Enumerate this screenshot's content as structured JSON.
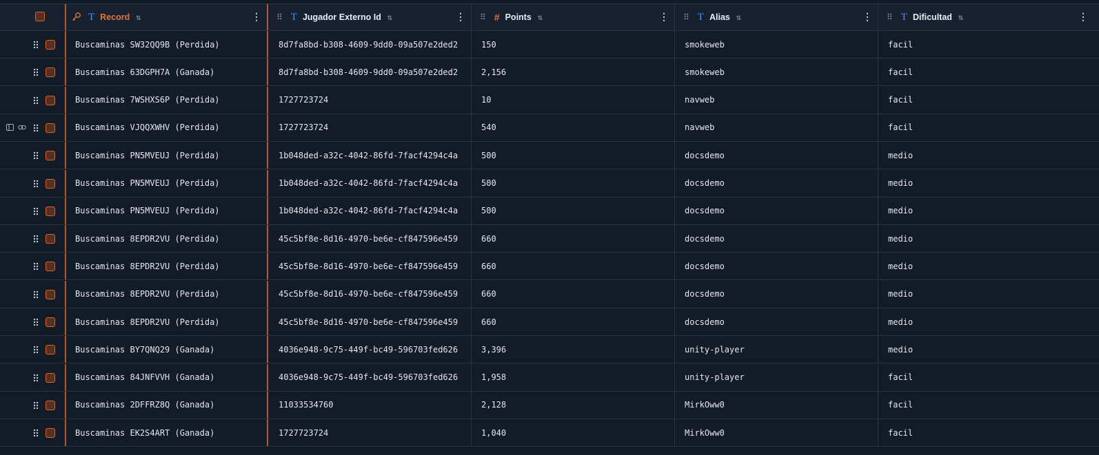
{
  "columns": {
    "record": "Record",
    "jugador": "Jugador Externo Id",
    "points": "Points",
    "alias": "Alias",
    "dificultad": "Dificultad"
  },
  "icons": {
    "text_type": "T",
    "number_type": "#",
    "sort": "⇅",
    "menu": "⋮"
  },
  "rows": [
    {
      "record": "Buscaminas SW32QQ9B (Perdida)",
      "jugador": "8d7fa8bd-b308-4609-9dd0-09a507e2ded2",
      "points": "150",
      "alias": "smokeweb",
      "dificultad": "facil"
    },
    {
      "record": "Buscaminas 63DGPH7A (Ganada)",
      "jugador": "8d7fa8bd-b308-4609-9dd0-09a507e2ded2",
      "points": "2,156",
      "alias": "smokeweb",
      "dificultad": "facil"
    },
    {
      "record": "Buscaminas 7WSHXS6P (Perdida)",
      "jugador": "1727723724",
      "points": "10",
      "alias": "navweb",
      "dificultad": "facil"
    },
    {
      "record": "Buscaminas VJQQXWHV (Perdida)",
      "jugador": "1727723724",
      "points": "540",
      "alias": "navweb",
      "dificultad": "facil"
    },
    {
      "record": "Buscaminas PN5MVEUJ (Perdida)",
      "jugador": "1b048ded-a32c-4042-86fd-7facf4294c4a",
      "points": "500",
      "alias": "docsdemo",
      "dificultad": "medio"
    },
    {
      "record": "Buscaminas PN5MVEUJ (Perdida)",
      "jugador": "1b048ded-a32c-4042-86fd-7facf4294c4a",
      "points": "500",
      "alias": "docsdemo",
      "dificultad": "medio"
    },
    {
      "record": "Buscaminas PN5MVEUJ (Perdida)",
      "jugador": "1b048ded-a32c-4042-86fd-7facf4294c4a",
      "points": "500",
      "alias": "docsdemo",
      "dificultad": "medio"
    },
    {
      "record": "Buscaminas 8EPDR2VU (Perdida)",
      "jugador": "45c5bf8e-8d16-4970-be6e-cf847596e459",
      "points": "660",
      "alias": "docsdemo",
      "dificultad": "medio"
    },
    {
      "record": "Buscaminas 8EPDR2VU (Perdida)",
      "jugador": "45c5bf8e-8d16-4970-be6e-cf847596e459",
      "points": "660",
      "alias": "docsdemo",
      "dificultad": "medio"
    },
    {
      "record": "Buscaminas 8EPDR2VU (Perdida)",
      "jugador": "45c5bf8e-8d16-4970-be6e-cf847596e459",
      "points": "660",
      "alias": "docsdemo",
      "dificultad": "medio"
    },
    {
      "record": "Buscaminas 8EPDR2VU (Perdida)",
      "jugador": "45c5bf8e-8d16-4970-be6e-cf847596e459",
      "points": "660",
      "alias": "docsdemo",
      "dificultad": "medio"
    },
    {
      "record": "Buscaminas BY7QNQ29 (Ganada)",
      "jugador": "4036e948-9c75-449f-bc49-596703fed626",
      "points": "3,396",
      "alias": "unity-player",
      "dificultad": "medio"
    },
    {
      "record": "Buscaminas 84JNFVVH (Ganada)",
      "jugador": "4036e948-9c75-449f-bc49-596703fed626",
      "points": "1,958",
      "alias": "unity-player",
      "dificultad": "facil"
    },
    {
      "record": "Buscaminas 2DFFRZ8Q (Ganada)",
      "jugador": "11033534760",
      "points": "2,128",
      "alias": "MirkOww0",
      "dificultad": "facil"
    },
    {
      "record": "Buscaminas EK2S4ART (Ganada)",
      "jugador": "1727723724",
      "points": "1,040",
      "alias": "MirkOww0",
      "dificultad": "facil"
    }
  ]
}
